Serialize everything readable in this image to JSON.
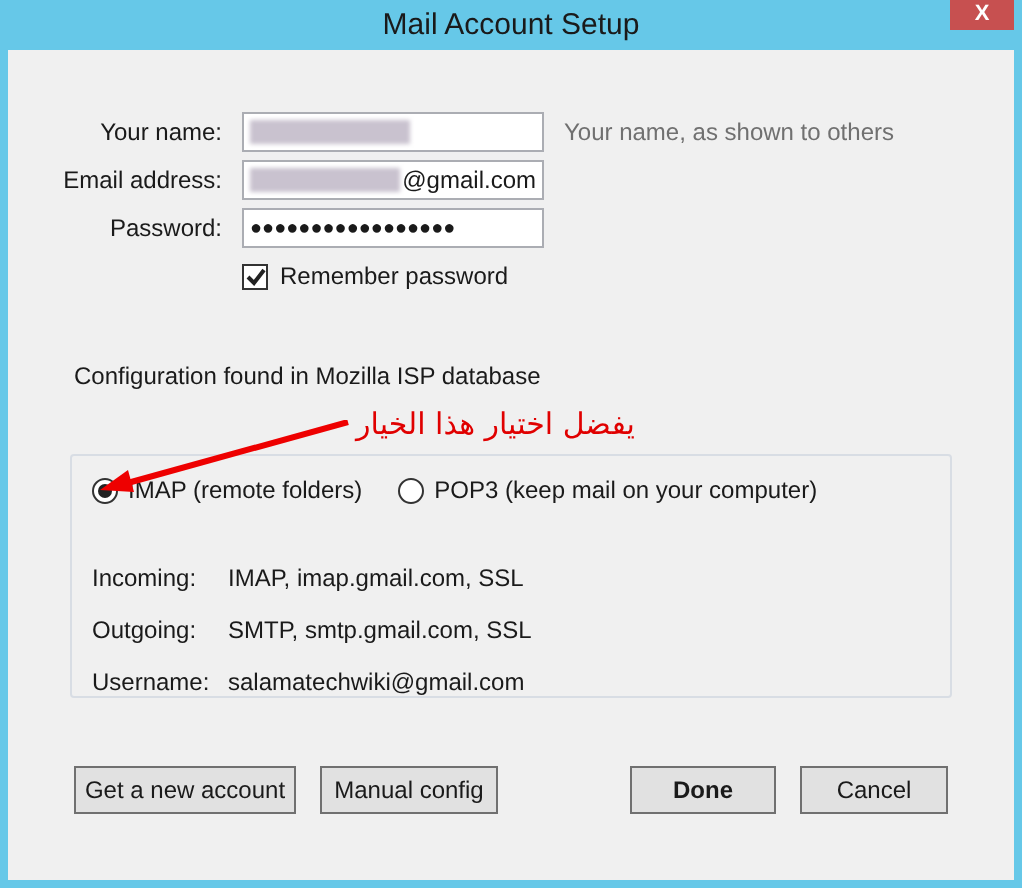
{
  "window": {
    "title": "Mail Account Setup",
    "close": "X"
  },
  "form": {
    "fields": [
      {
        "label": "Your name:",
        "redacted": true,
        "hint": "Your name, as shown to others"
      },
      {
        "label": "Email address:",
        "value": "@gmail.com",
        "redacted": true
      },
      {
        "label": "Password:",
        "value": "●●●●●●●●●●●●●●●●●",
        "redacted": false
      }
    ],
    "remember": {
      "label": "Remember password",
      "checked": true
    }
  },
  "status": "Configuration found in Mozilla ISP database",
  "annotation": "يفضل اختيار هذا الخيار",
  "protocols": [
    {
      "label": "IMAP (remote folders)",
      "selected": true
    },
    {
      "label": "POP3 (keep mail on your computer)",
      "selected": false
    }
  ],
  "servers": [
    {
      "label": "Incoming:",
      "value": "IMAP, imap.gmail.com, SSL"
    },
    {
      "label": "Outgoing:",
      "value": "SMTP, smtp.gmail.com, SSL"
    },
    {
      "label": "Username:",
      "value": "salamatechwiki@gmail.com"
    }
  ],
  "buttons": [
    {
      "label": "Get a new account",
      "default": false
    },
    {
      "label": "Manual config",
      "default": false
    },
    {
      "label": "Done",
      "default": true
    },
    {
      "label": "Cancel",
      "default": false
    }
  ]
}
